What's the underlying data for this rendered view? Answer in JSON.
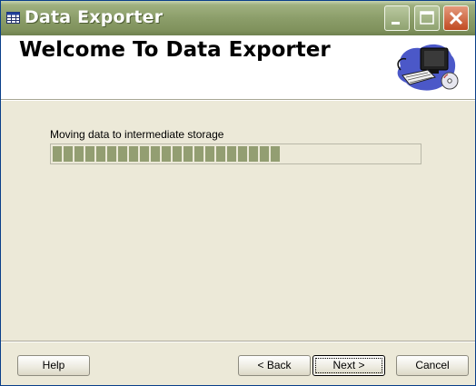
{
  "window": {
    "title": "Data Exporter",
    "icon": "table-app-icon"
  },
  "banner": {
    "title": "Welcome To Data Exporter",
    "art": "computer-with-disc-icon"
  },
  "progress": {
    "label": "Moving data to intermediate storage",
    "fraction": 0.65
  },
  "buttons": {
    "help": "Help",
    "back": "< Back",
    "next": "Next >",
    "cancel": "Cancel"
  },
  "colors": {
    "titlebar": "#8c9e6a",
    "progress_fill": "#939e72",
    "face": "#ece9d8"
  }
}
